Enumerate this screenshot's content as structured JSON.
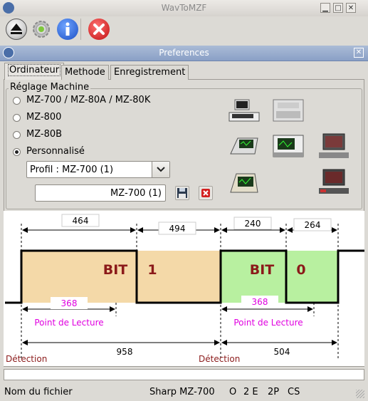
{
  "window": {
    "title": "WavToMZF",
    "min": "▁",
    "max": "□",
    "close": "✕"
  },
  "toolbar": {
    "items": [
      "eject-icon",
      "settings-icon",
      "info-icon",
      "close-icon"
    ]
  },
  "dialog": {
    "title": "Preferences",
    "tabs": [
      "Ordinateur",
      "Methode",
      "Enregistrement"
    ],
    "group_label": "Réglage Machine",
    "radios": [
      {
        "label": "MZ-700 / MZ-80A / MZ-80K",
        "checked": false
      },
      {
        "label": "MZ-800",
        "checked": false
      },
      {
        "label": "MZ-80B",
        "checked": false
      },
      {
        "label": "Personnalisé",
        "checked": true
      }
    ],
    "profile_select": "Profil : MZ-700 (1)",
    "profile_name": "MZ-700 (1)"
  },
  "diagram": {
    "bit1_label": "BIT",
    "bit1_value": "1",
    "bit0_label": "BIT",
    "bit0_value": "0",
    "dim_464": "464",
    "dim_494": "494",
    "dim_240": "240",
    "dim_264": "264",
    "read1": "368",
    "read0": "368",
    "point_label_1": "Point de Lecture",
    "point_label_0": "Point de Lecture",
    "detect_1": "Détection",
    "detect_2": "Détection",
    "dim_958": "958",
    "dim_504": "504",
    "colors": {
      "bit1": "#f4d9a8",
      "bit0": "#b8f0a0",
      "label": "#8b1a1a",
      "pink": "#e000e0"
    }
  },
  "status": {
    "filename": "Nom du fichier",
    "machine": "Sharp MZ-700",
    "o": "O",
    "e": "2 E",
    "p": "2P",
    "cs": "CS"
  }
}
